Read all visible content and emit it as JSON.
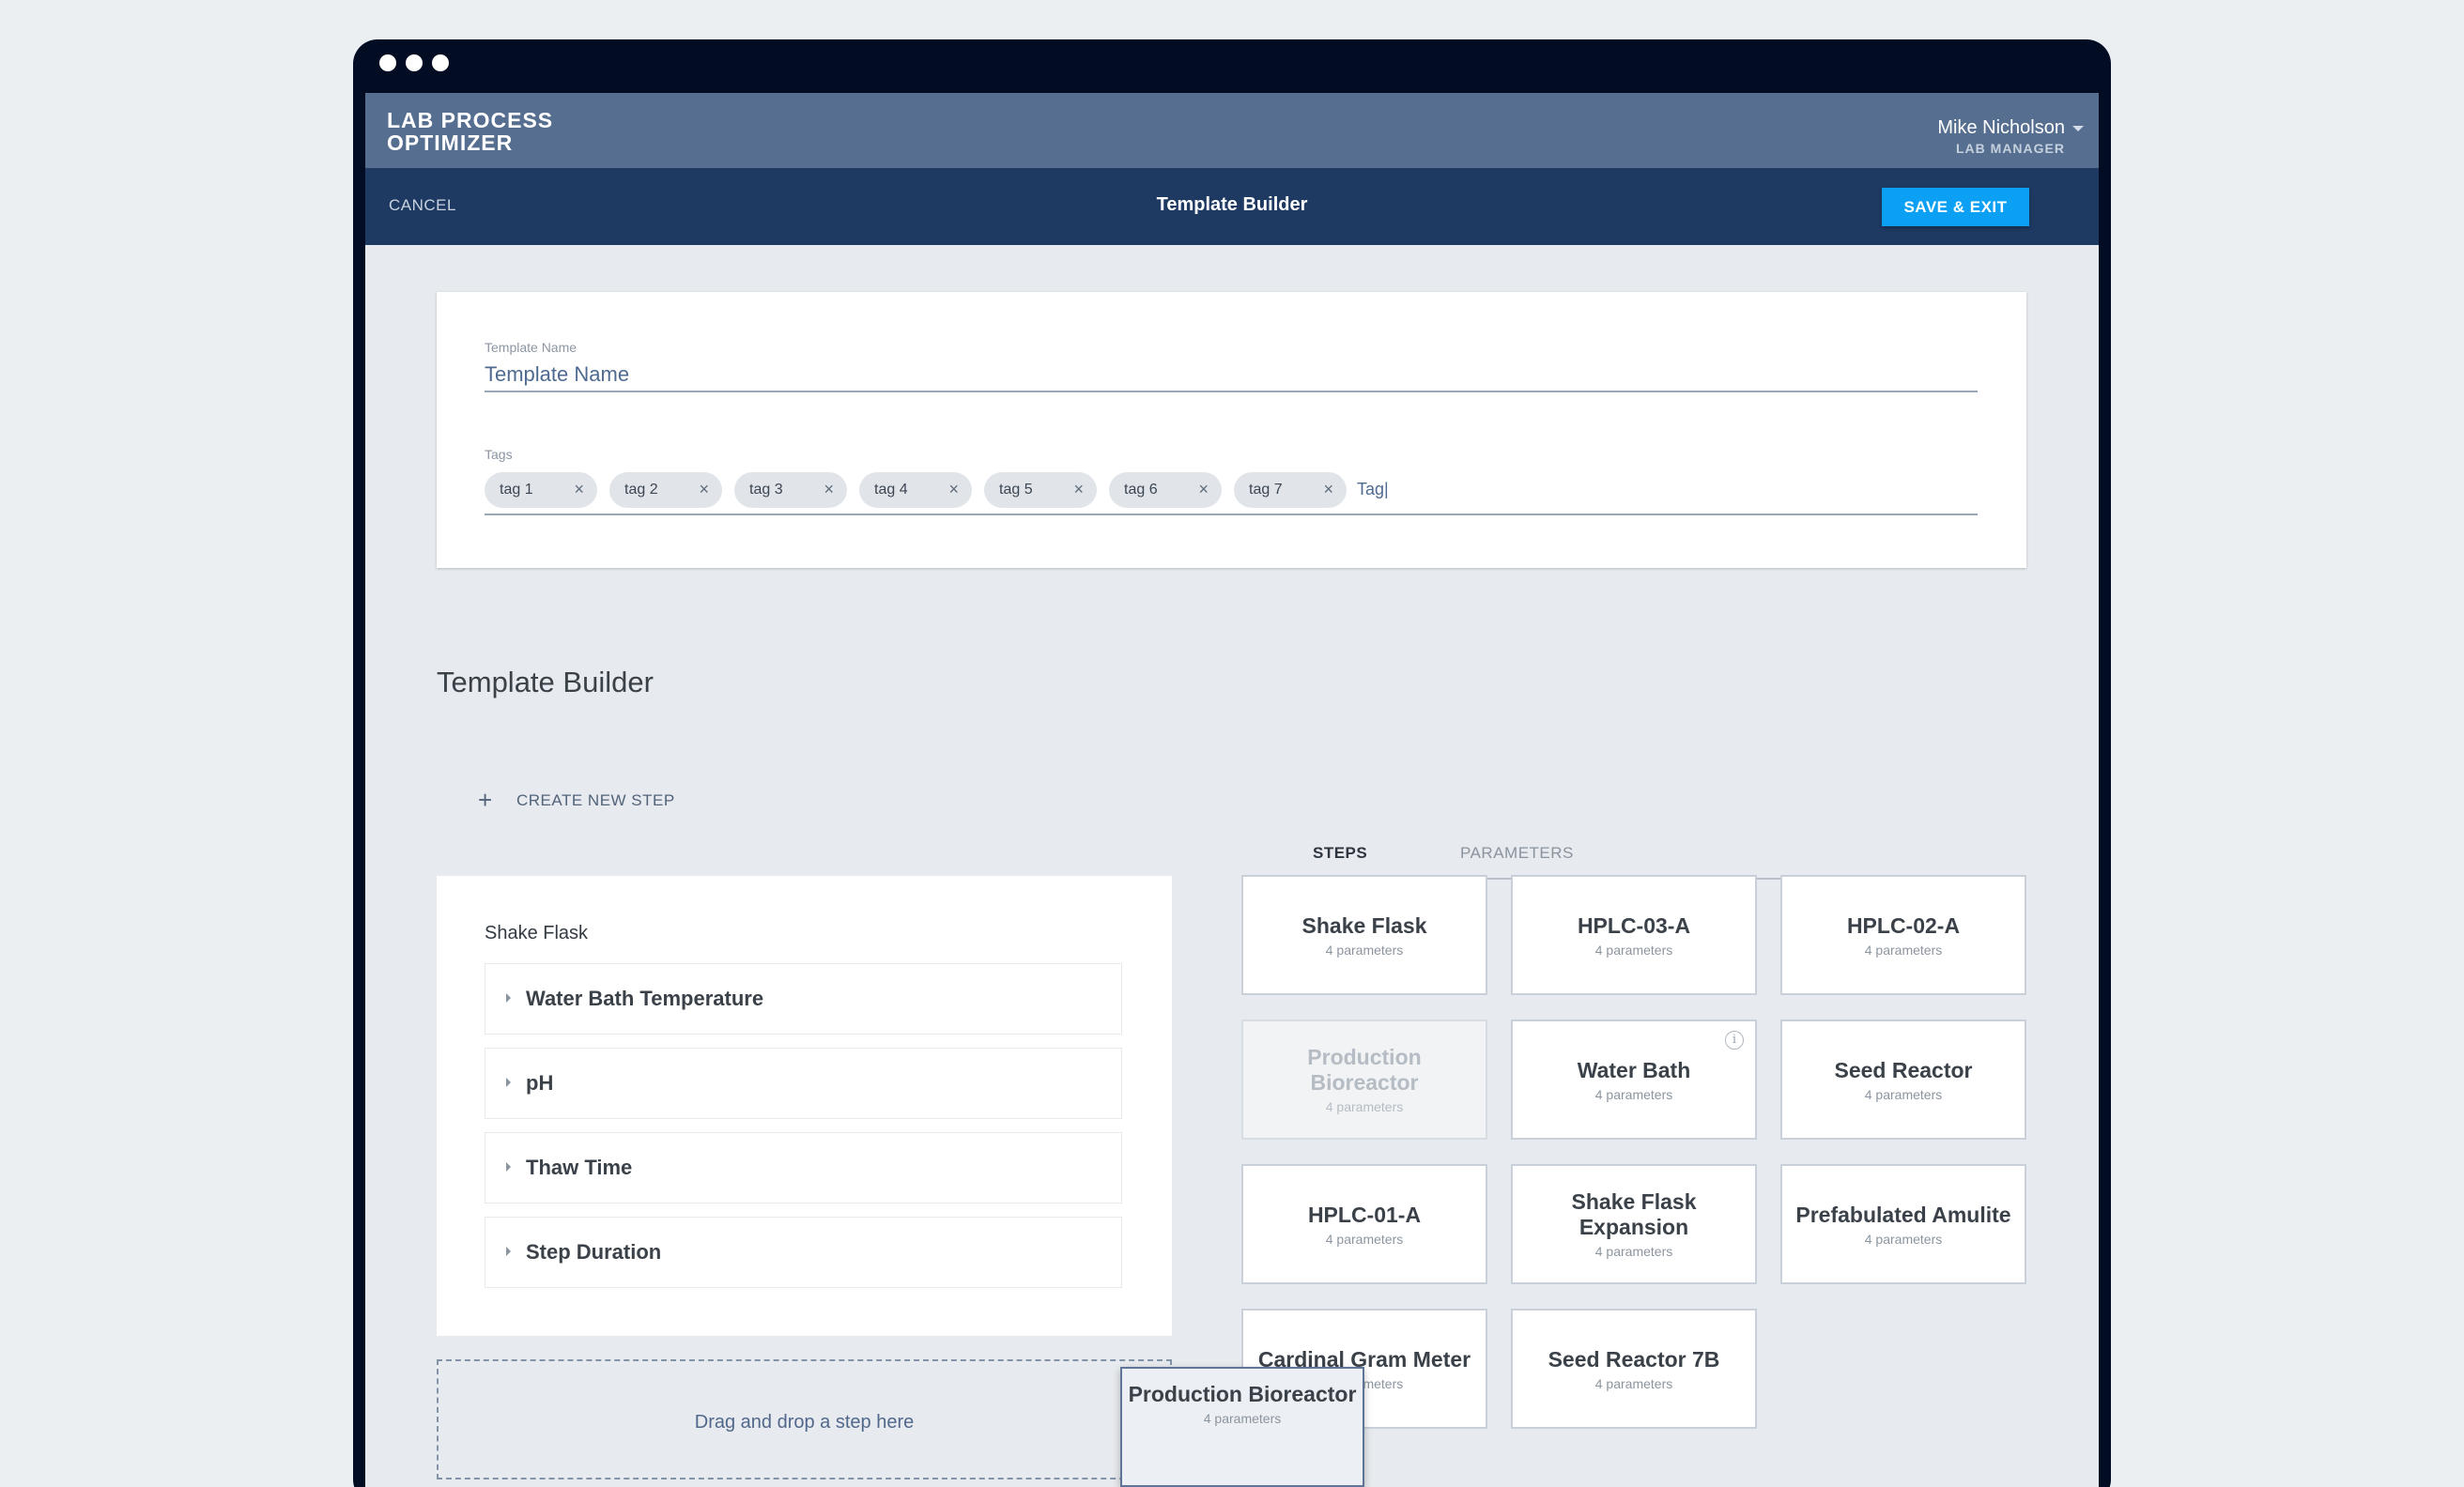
{
  "app": {
    "logo_line1": "LAB PROCESS",
    "logo_line2": "OPTIMIZER",
    "user_name": "Mike Nicholson",
    "user_role": "LAB MANAGER"
  },
  "toolbar": {
    "cancel_label": "CANCEL",
    "title": "Template Builder",
    "save_label": "SAVE & EXIT"
  },
  "form": {
    "name_label": "Template Name",
    "name_placeholder": "Template Name",
    "tags_label": "Tags",
    "tags": [
      "tag 1",
      "tag 2",
      "tag 3",
      "tag 4",
      "tag 5",
      "tag 6",
      "tag 7"
    ],
    "tag_input_value": "Tag|"
  },
  "builder": {
    "section_title": "Template Builder",
    "create_step_label": "CREATE NEW STEP",
    "step": {
      "title": "Shake Flask",
      "parameters": [
        "Water Bath Temperature",
        "pH",
        "Thaw Time",
        "Step Duration"
      ]
    },
    "dropzone_text": "Drag and drop a step here"
  },
  "library": {
    "tabs": [
      {
        "label": "STEPS",
        "active": true
      },
      {
        "label": "PARAMETERS",
        "active": false
      }
    ],
    "cards": [
      {
        "title": "Shake Flask",
        "sub": "4 parameters",
        "disabled": false,
        "info": false
      },
      {
        "title": "HPLC-03-A",
        "sub": "4 parameters",
        "disabled": false,
        "info": false
      },
      {
        "title": "HPLC-02-A",
        "sub": "4 parameters",
        "disabled": false,
        "info": false
      },
      {
        "title": "Production Bioreactor",
        "sub": "4 parameters",
        "disabled": true,
        "info": false
      },
      {
        "title": "Water Bath",
        "sub": "4 parameters",
        "disabled": false,
        "info": true
      },
      {
        "title": "Seed Reactor",
        "sub": "4 parameters",
        "disabled": false,
        "info": false
      },
      {
        "title": "HPLC-01-A",
        "sub": "4 parameters",
        "disabled": false,
        "info": false
      },
      {
        "title": "Shake Flask Expansion",
        "sub": "4 parameters",
        "disabled": false,
        "info": false
      },
      {
        "title": "Prefabulated Amulite",
        "sub": "4 parameters",
        "disabled": false,
        "info": false
      },
      {
        "title": "Cardinal Gram Meter",
        "sub": "4 parameters",
        "disabled": false,
        "info": false
      },
      {
        "title": "Seed Reactor 7B",
        "sub": "4 parameters",
        "disabled": false,
        "info": false
      }
    ]
  },
  "drag_ghost": {
    "title": "Production Bioreactor",
    "sub": "4 parameters"
  },
  "colors": {
    "window_frame": "#020d24",
    "top_bar": "#566e8f",
    "sub_bar": "#1e3a63",
    "accent": "#0ba0f3"
  },
  "icons": {
    "window_controls": "dot",
    "tag_remove": "close-icon",
    "create_step": "plus-icon",
    "param_toggle": "caret-right-icon",
    "card_info": "info-icon",
    "user_menu": "chevron-down-icon"
  }
}
